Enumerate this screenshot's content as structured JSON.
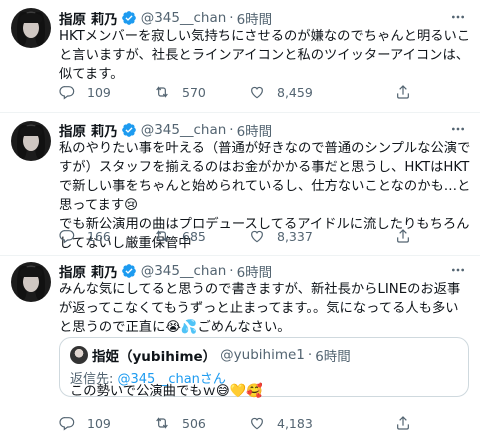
{
  "colors": {
    "verified": "#1d9bf0",
    "secondary_text": "#536471",
    "link": "#1d9bf0"
  },
  "tweets": [
    {
      "name": "指原 莉乃",
      "handle": "@345__chan",
      "separator": "·",
      "time": "6時間",
      "text": "HKTメンバーを寂しい気持ちにさせるのが嫌なのでちゃんと明るいこと言いますが、社長とラインアイコンと私のツイッターアイコンは、似てます。",
      "counts": {
        "reply": "109",
        "retweet": "570",
        "like": "8,459"
      }
    },
    {
      "name": "指原 莉乃",
      "handle": "@345__chan",
      "separator": "·",
      "time": "6時間",
      "text": "私のやりたい事を叶える（普通が好きなので普通のシンプルな公演ですが）スタッフを揃えるのはお金がかかる事だと思うし、HKTはHKTで新しい事をちゃんと始められているし、仕方ないことなのかも…と思ってます😢\nでも新公演用の曲はプロデュースしてるアイドルに流したりもちろんしてないし厳重保管中",
      "counts": {
        "reply": "166",
        "retweet": "685",
        "like": "8,337"
      }
    },
    {
      "name": "指原 莉乃",
      "handle": "@345__chan",
      "separator": "·",
      "time": "6時間",
      "text": "みんな気にしてると思うので書きますが、新社長からLINEのお返事が返ってこなくてもうずっと止まってます。。気になってる人も多いと思うので正直に😭💦ごめんなさい。",
      "counts": {
        "reply": "109",
        "retweet": "506",
        "like": "4,183"
      },
      "quote": {
        "name": "指姫（yubihime）",
        "handle": "@yubihime1",
        "separator": "·",
        "time": "6時間",
        "reply_prefix": "返信先: ",
        "reply_to": "@345__chanさん",
        "text": "この勢いで公演曲でもｗ😅💛🥰"
      }
    }
  ],
  "icons": [
    "verified-badge-icon",
    "more-icon",
    "reply-icon",
    "retweet-icon",
    "like-icon",
    "share-icon"
  ]
}
